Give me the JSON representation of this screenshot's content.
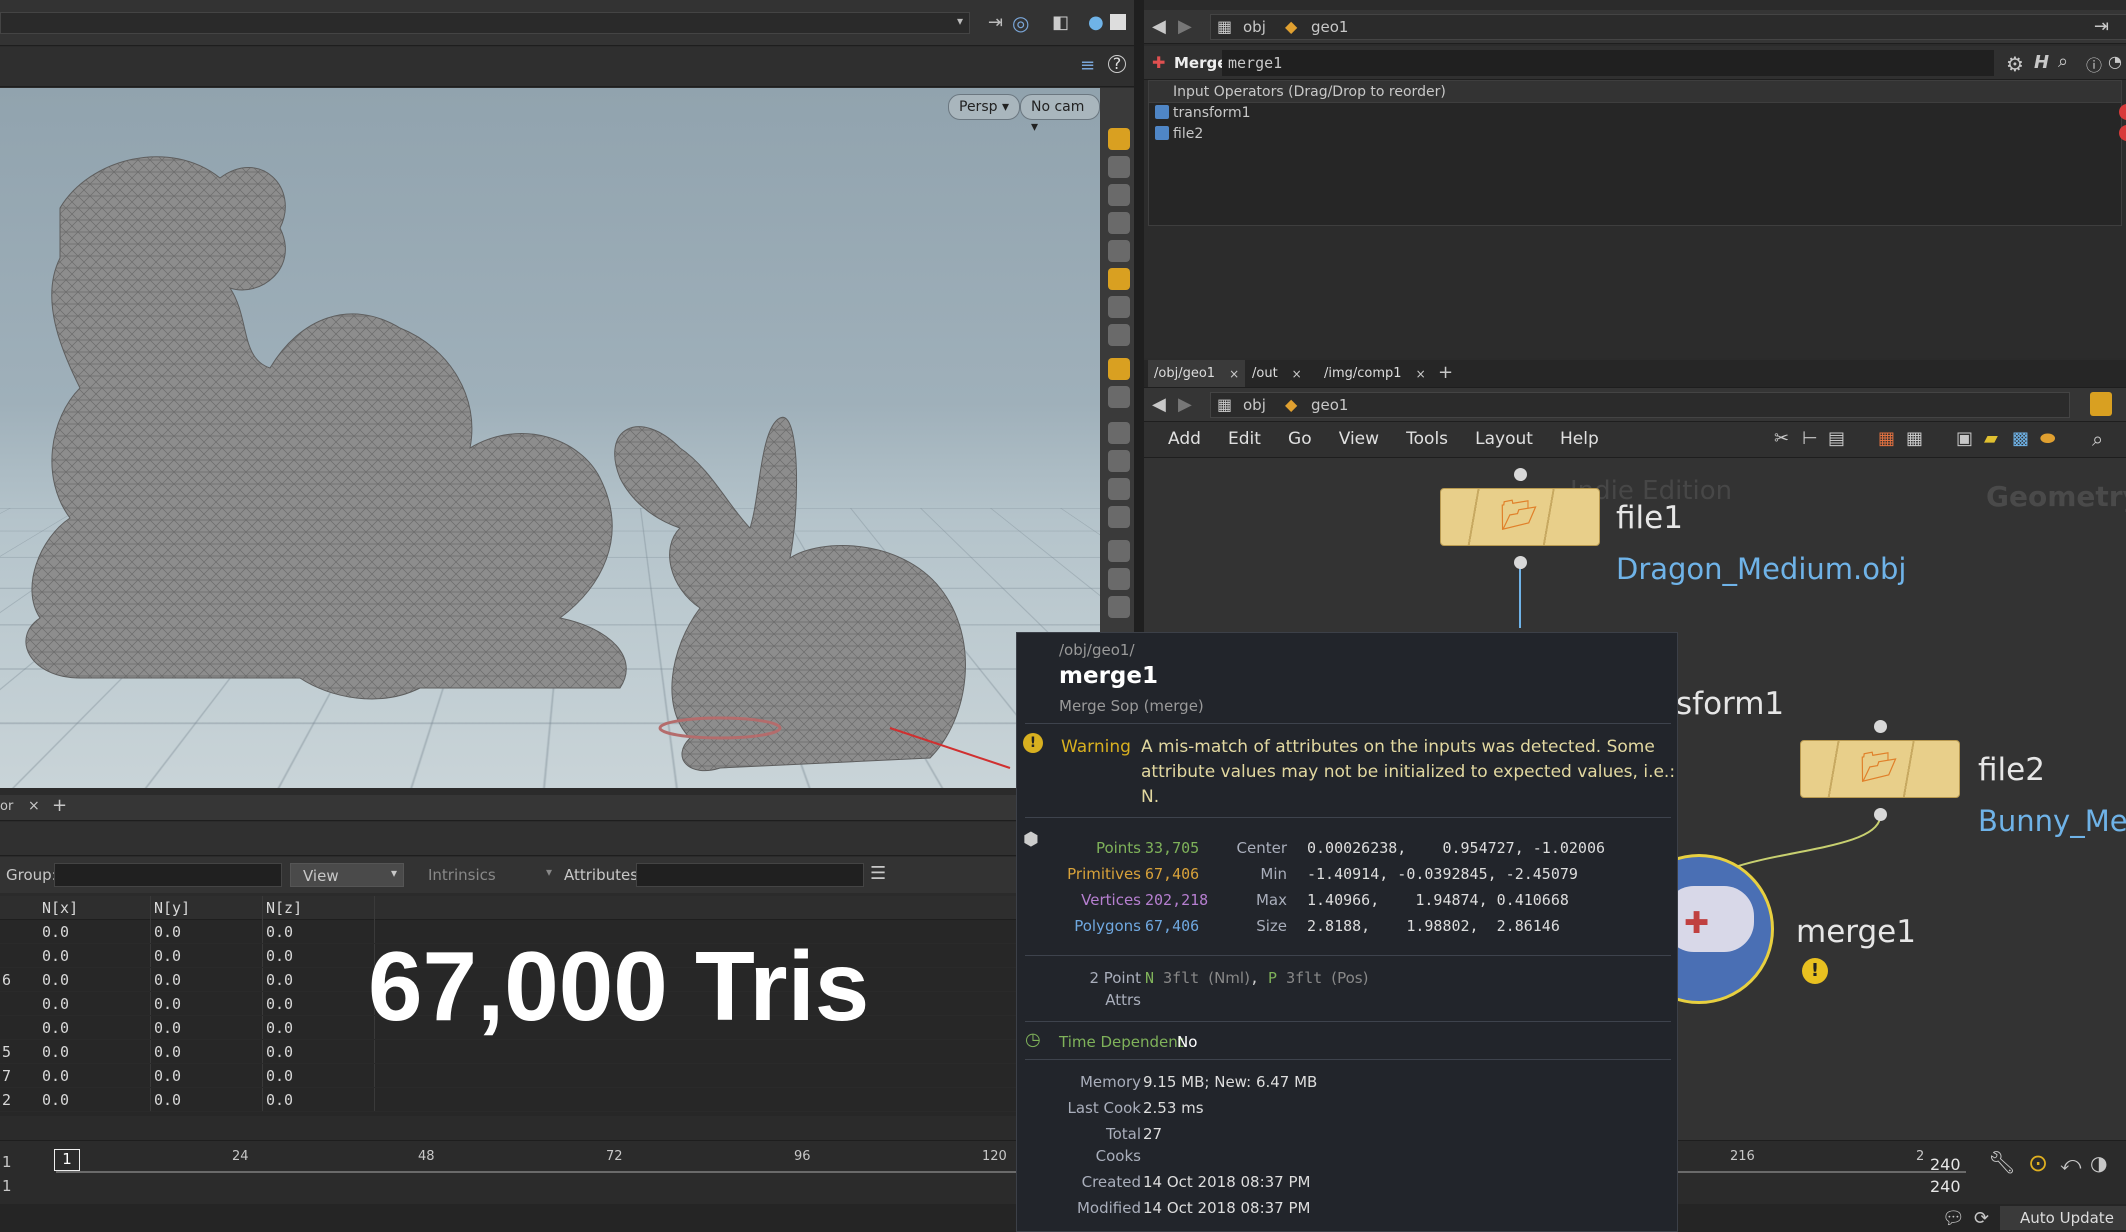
{
  "viewport": {
    "persp_label": "Persp",
    "cam_label": "No cam",
    "overlay_text": "67,000 Tris"
  },
  "params": {
    "nav": {
      "path_obj": "obj",
      "path_geo": "geo1"
    },
    "node_type": "Merge",
    "node_name": "merge1",
    "input_header": "Input Operators (Drag/Drop to reorder)",
    "inputs": [
      {
        "name": "transform1"
      },
      {
        "name": "file2"
      }
    ]
  },
  "network": {
    "tabs": [
      {
        "label": "/obj/geo1"
      },
      {
        "label": "/out"
      },
      {
        "label": "/img/comp1"
      }
    ],
    "nav": {
      "path_obj": "obj",
      "path_geo": "geo1"
    },
    "menu": [
      "Add",
      "Edit",
      "Go",
      "View",
      "Tools",
      "Layout",
      "Help"
    ],
    "watermark": "Indie Edition",
    "context_label": "Geometry",
    "nodes": {
      "file1": {
        "name": "file1",
        "file": "Dragon_Medium.obj"
      },
      "transform1": {
        "name_fragment": "sform1"
      },
      "file2": {
        "name": "file2",
        "file": "Bunny_Me"
      },
      "merge1": {
        "name": "merge1"
      }
    }
  },
  "spreadsheet": {
    "group_label": "Group:",
    "view_label": "View",
    "intrinsics_label": "Intrinsics",
    "attributes_label": "Attributes:",
    "columns": [
      "N[x]",
      "N[y]",
      "N[z]"
    ],
    "row_index_fragments": [
      "",
      "",
      "6",
      "",
      "",
      "5",
      "7",
      "2"
    ],
    "rows": [
      [
        "0.0",
        "0.0",
        "0.0"
      ],
      [
        "0.0",
        "0.0",
        "0.0"
      ],
      [
        "0.0",
        "0.0",
        "0.0"
      ],
      [
        "0.0",
        "0.0",
        "0.0"
      ],
      [
        "0.0",
        "0.0",
        "0.0"
      ],
      [
        "0.0",
        "0.0",
        "0.0"
      ],
      [
        "0.0",
        "0.0",
        "0.0"
      ],
      [
        "0.0",
        "0.0",
        "0.0"
      ]
    ],
    "tab_fragment": "or"
  },
  "timeline": {
    "frame_left_top": "1",
    "frame_left_bottom": "1",
    "current_frame": "1",
    "ticks": [
      "24",
      "48",
      "72",
      "96",
      "120",
      "216"
    ],
    "end_top": "240",
    "end_bottom": "240",
    "tick_right": "2",
    "auto_update": "Auto Update"
  },
  "info": {
    "path": "/obj/geo1/",
    "name": "merge1",
    "type": "Merge Sop (merge)",
    "warning_label": "Warning",
    "warning_lines": [
      "A mis-match of attributes on the inputs was detected. Some",
      "attribute values may not be initialized to expected values, i.e.:",
      "N."
    ],
    "stats": [
      {
        "label": "Points",
        "value": "33,705",
        "color": "#7fb25a",
        "col2": "Center",
        "col3": "0.00026238,    0.954727, -1.02006"
      },
      {
        "label": "Primitives",
        "value": "67,406",
        "color": "#d8a23a",
        "col2": "Min",
        "col3": "-1.40914, -0.0392845, -2.45079"
      },
      {
        "label": "Vertices",
        "value": "202,218",
        "color": "#b67fd0",
        "col2": "Max",
        "col3": "1.40966,    1.94874, 0.410668"
      },
      {
        "label": "Polygons",
        "value": "67,406",
        "color": "#6fa8e0",
        "col2": "Size",
        "col3": "2.8188,    1.98802,  2.86146"
      }
    ],
    "attrs_count": "2 Point",
    "attrs_label": "Attrs",
    "attr1_name": "N",
    "attr1_type": "3flt",
    "attr1_desc": "(Nml)",
    "attr2_name": "P",
    "attr2_type": "3flt",
    "attr2_desc": "(Pos)",
    "time_dep_label": "Time Dependent",
    "time_dep_value": "No",
    "memory_label": "Memory",
    "memory_value": "9.15 MB; New: 6.47 MB",
    "lastcook_label": "Last Cook",
    "lastcook_value": "2.53 ms",
    "total_label": "Total",
    "cooks_label": "Cooks",
    "total_value": "27",
    "created_label": "Created",
    "created_value": "14 Oct 2018 08:37 PM",
    "modified_label": "Modified",
    "modified_value": "14 Oct 2018 08:37 PM"
  }
}
